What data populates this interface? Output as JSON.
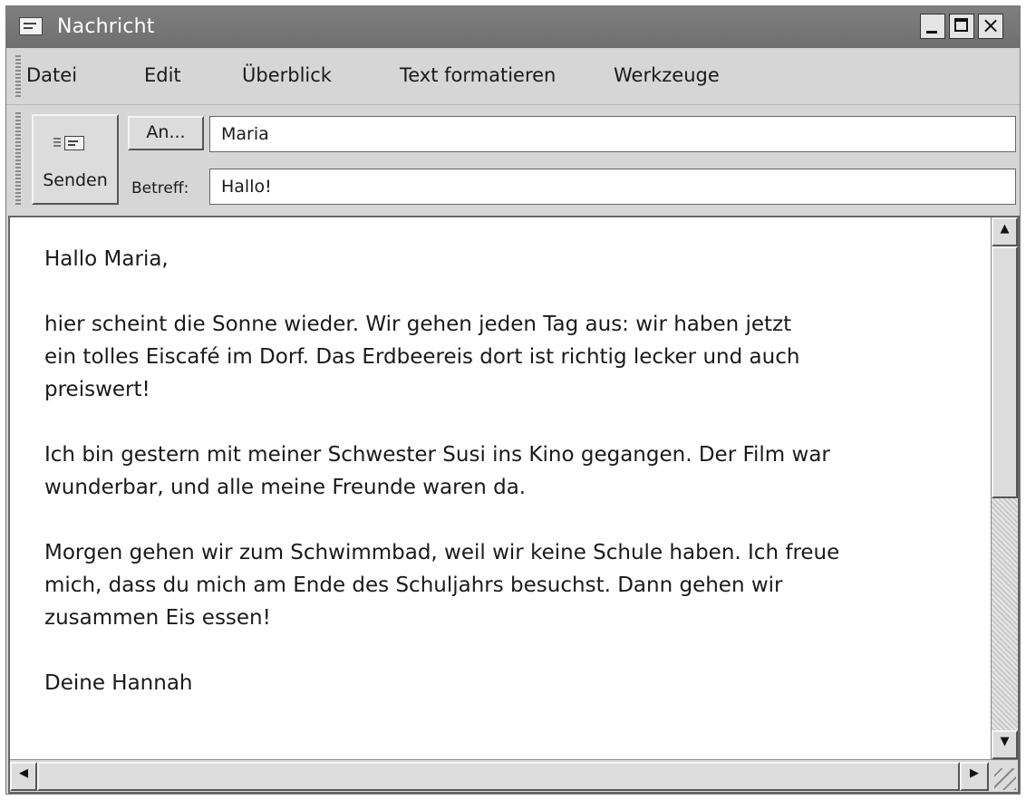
{
  "window": {
    "title": "Nachricht"
  },
  "menu": {
    "items": [
      {
        "label": "Datei"
      },
      {
        "label": "Edit"
      },
      {
        "label": "Überblick"
      },
      {
        "label": "Text formatieren"
      },
      {
        "label": "Werkzeuge"
      }
    ]
  },
  "compose": {
    "send_label": "Senden",
    "to_button": "An...",
    "to_value": "Maria",
    "subject_label": "Betreff:",
    "subject_value": "Hallo!"
  },
  "message": {
    "paragraphs": [
      "Hallo Maria,",
      "hier scheint die Sonne wieder. Wir gehen jeden Tag aus: wir haben jetzt\nein tolles Eiscafé im Dorf. Das Erdbeereis dort ist richtig lecker und auch\npreiswert!",
      "Ich bin gestern mit meiner Schwester Susi ins Kino gegangen. Der Film war\nwunderbar, und alle meine Freunde waren da.",
      "Morgen gehen wir zum Schwimmbad, weil wir keine Schule haben. Ich freue\nmich, dass du mich am Ende des Schuljahrs besuchst.  Dann gehen wir\nzusammen Eis essen!",
      "Deine Hannah"
    ]
  },
  "icons": {
    "title": "message-icon",
    "send": "send-mail-icon",
    "minimize": "minimize-icon",
    "maximize": "maximize-icon",
    "close": "close-icon",
    "scroll_up": "arrow-up-icon",
    "scroll_down": "arrow-down-icon",
    "scroll_left": "arrow-left-icon",
    "scroll_right": "arrow-right-icon"
  },
  "colors": {
    "titlebar": "#787878",
    "chrome": "#d6d6d6",
    "text": "#1a1a1a"
  }
}
